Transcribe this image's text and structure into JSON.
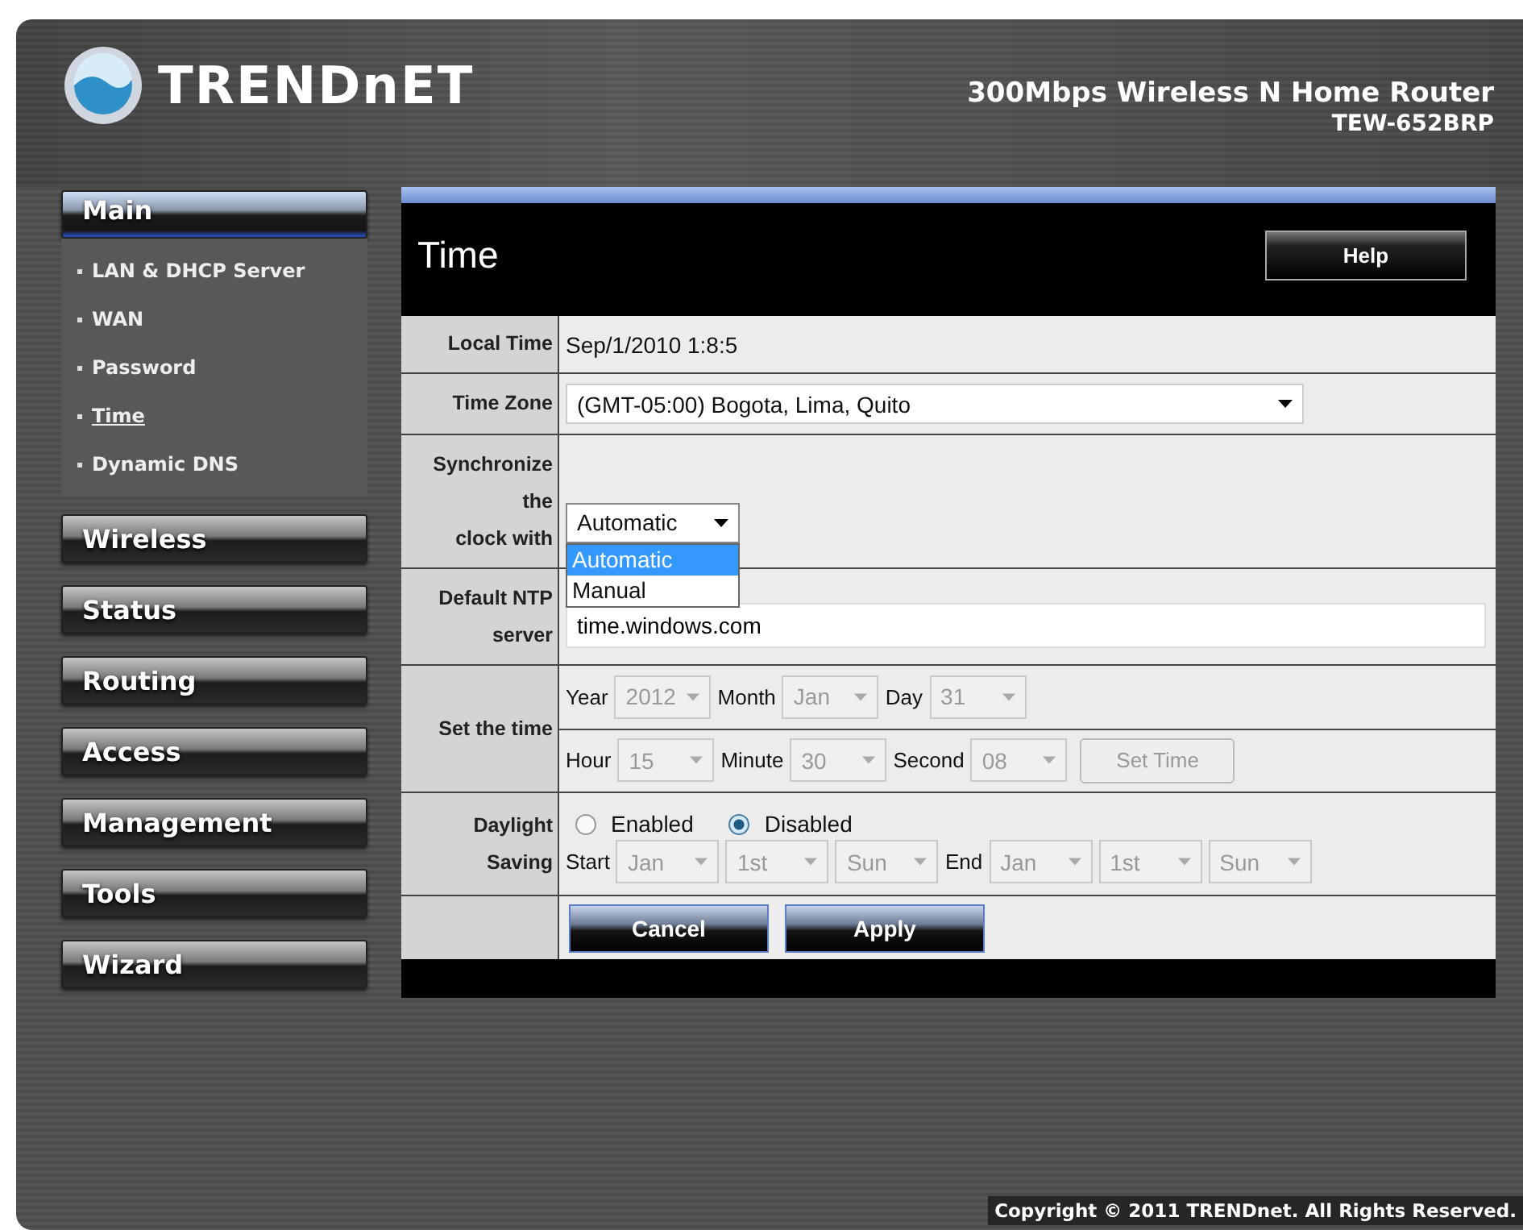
{
  "header": {
    "logo": "TRENDnET",
    "product": "300Mbps Wireless N Home Router",
    "model": "TEW-652BRP"
  },
  "sidebar": [
    {
      "label": "Main",
      "selected": true,
      "children": [
        {
          "label": "LAN & DHCP Server",
          "selected": false
        },
        {
          "label": "WAN",
          "selected": false
        },
        {
          "label": "Password",
          "selected": false
        },
        {
          "label": "Time",
          "selected": true
        },
        {
          "label": "Dynamic DNS",
          "selected": false
        }
      ]
    },
    {
      "label": "Wireless",
      "selected": false
    },
    {
      "label": "Status",
      "selected": false
    },
    {
      "label": "Routing",
      "selected": false
    },
    {
      "label": "Access",
      "selected": false
    },
    {
      "label": "Management",
      "selected": false
    },
    {
      "label": "Tools",
      "selected": false
    },
    {
      "label": "Wizard",
      "selected": false
    }
  ],
  "page": {
    "title": "Time",
    "help_button": "Help"
  },
  "rows": [
    {
      "kind": "text",
      "label": "Local Time",
      "value": "Sep/1/2010 1:8:5"
    },
    {
      "kind": "select",
      "label": "Time Zone",
      "value": "(GMT-05:00) Bogota, Lima, Quito"
    },
    {
      "kind": "dropdown",
      "label": "Synchronize\nthe\nclock with",
      "value": "Automatic",
      "expanded": true,
      "options": [
        {
          "label": "Automatic",
          "selected": true
        },
        {
          "label": "Manual",
          "selected": false
        }
      ]
    },
    {
      "kind": "input",
      "label": "Default NTP server",
      "value": "time.windows.com"
    },
    {
      "kind": "datetime",
      "label": "Set the time",
      "disabled": true,
      "lines": [
        [
          {
            "label": "Year",
            "value": "2012"
          },
          {
            "label": "Month",
            "value": "Jan"
          },
          {
            "label": "Day",
            "value": "31"
          }
        ],
        [
          {
            "label": "Hour",
            "value": "15"
          },
          {
            "label": "Minute",
            "value": "30"
          },
          {
            "label": "Second",
            "value": "08"
          }
        ]
      ],
      "button": "Set Time"
    },
    {
      "kind": "daylight",
      "label": "Daylight Saving",
      "disabled": true,
      "radios": [
        {
          "label": "Enabled",
          "selected": false
        },
        {
          "label": "Disabled",
          "selected": true
        }
      ],
      "groups": [
        {
          "label": "Start",
          "values": [
            "Jan",
            "1st",
            "Sun"
          ]
        },
        {
          "label": "End",
          "values": [
            "Jan",
            "1st",
            "Sun"
          ]
        }
      ]
    },
    {
      "kind": "buttons",
      "buttons": [
        "Cancel",
        "Apply"
      ]
    }
  ],
  "footer": {
    "copyright": "Copyright © 2011 TRENDnet. All Rights Reserved."
  }
}
